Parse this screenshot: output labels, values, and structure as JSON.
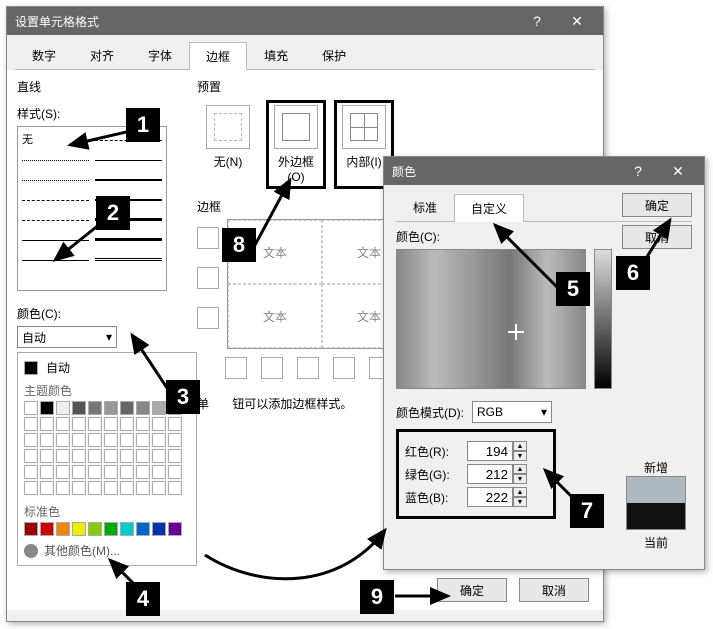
{
  "mainDialog": {
    "title": "设置单元格格式",
    "tabs": [
      "数字",
      "对齐",
      "字体",
      "边框",
      "填充",
      "保护"
    ],
    "activeTab": "边框",
    "lineSection": "直线",
    "styleLabel": "样式(S):",
    "noneLabel": "无",
    "colorLabel": "颜色(C):",
    "colorValue": "自动",
    "autoItem": "自动",
    "themeColorsLabel": "主题颜色",
    "standardColorsLabel": "标准色",
    "moreColorsLabel": "其他颜色(M)...",
    "presetSection": "预置",
    "presets": {
      "none": "无(N)",
      "outline": "外边框(O)",
      "inside": "内部(I)"
    },
    "borderSection": "边框",
    "sampleText": "文本",
    "hintSuffix": "钮可以添加边框样式。",
    "hintPrefix": "单",
    "ok": "确定",
    "cancel": "取消"
  },
  "colorDialog": {
    "title": "颜色",
    "tabs": [
      "标准",
      "自定义"
    ],
    "activeTab": "自定义",
    "colorLabel": "颜色(C):",
    "modeLabel": "颜色模式(D):",
    "modeValue": "RGB",
    "channels": {
      "r": {
        "label": "红色(R):",
        "value": 194
      },
      "g": {
        "label": "绿色(G):",
        "value": 212
      },
      "b": {
        "label": "蓝色(B):",
        "value": 222
      }
    },
    "newLabel": "新增",
    "currentLabel": "当前",
    "ok": "确定",
    "cancel": "取消"
  },
  "markers": [
    "1",
    "2",
    "3",
    "4",
    "5",
    "6",
    "7",
    "8",
    "9"
  ]
}
